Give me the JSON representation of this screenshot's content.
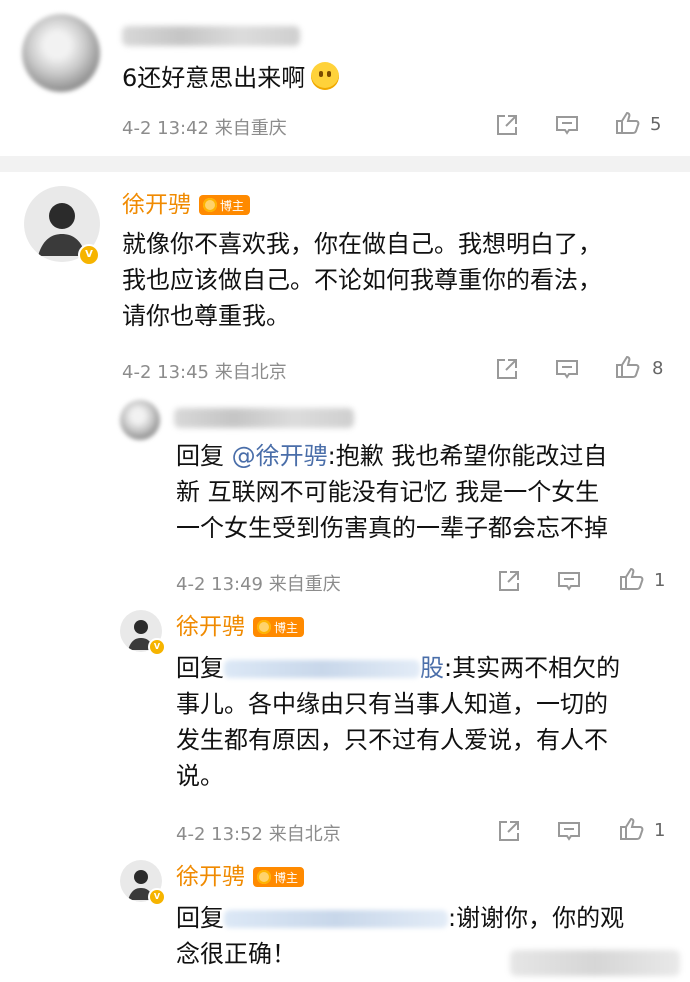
{
  "c1": {
    "text": "6还好意思出来啊",
    "meta": "4-2 13:42 来自重庆",
    "likes": "5"
  },
  "c2": {
    "author": "徐开骋",
    "badge": "博主",
    "l1": "就像你不喜欢我，你在做自己。我想明白了，",
    "l2": "我也应该做自己。不论如何我尊重你的看法，",
    "l3": "请你也尊重我。",
    "meta": "4-2 13:45 来自北京",
    "likes": "8"
  },
  "r1": {
    "reply_prefix": "回复",
    "mention": "@徐开骋",
    "l1": ":抱歉 我也希望你能改过自",
    "l2": "新 互联网不可能没有记忆 我是一个女生",
    "l3": "一个女生受到伤害真的一辈子都会忘不掉",
    "meta": "4-2 13:49 来自重庆",
    "likes": "1"
  },
  "r2": {
    "author": "徐开骋",
    "badge": "博主",
    "reply_prefix": "回复",
    "tail": "股",
    "l1": ":其实两不相欠的",
    "l2": "事儿。各中缘由只有当事人知道，一切的",
    "l3": "发生都有原因，只不过有人爱说，有人不",
    "l4": "说。",
    "meta": "4-2 13:52 来自北京",
    "likes": "1"
  },
  "r3": {
    "author": "徐开骋",
    "badge": "博主",
    "reply_prefix": "回复",
    "l1": ":谢谢你，你的观",
    "l2": "念很正确！"
  }
}
